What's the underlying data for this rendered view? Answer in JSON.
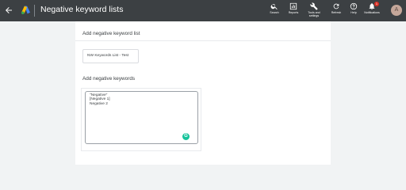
{
  "header": {
    "title": "Negative keyword lists",
    "back_icon": "arrow-back-icon",
    "logo_icon": "google-ads-logo-icon",
    "tools": [
      {
        "label": "Search",
        "icon": "search-icon"
      },
      {
        "label": "Reports",
        "icon": "reports-icon"
      },
      {
        "label": "Tools and settings",
        "icon": "wrench-icon"
      },
      {
        "label": "Refresh",
        "icon": "refresh-icon"
      },
      {
        "label": "Help",
        "icon": "help-icon"
      },
      {
        "label": "Notifications",
        "icon": "bell-icon",
        "badge": "1"
      }
    ],
    "avatar_initial": "A"
  },
  "form": {
    "add_list_title": "Add negative keyword list",
    "list_name_value": "NW Keywords List - Test",
    "add_keywords_title": "Add negative keywords",
    "keywords": [
      "\"Negative\"",
      "[Negative 1]",
      "Negative 2"
    ]
  },
  "colors": {
    "topbar": "#3c4043",
    "page_bg": "#f1f3f4",
    "panel_bg": "#ffffff",
    "notification_badge": "#d93025",
    "grammarly": "#15c39a"
  }
}
